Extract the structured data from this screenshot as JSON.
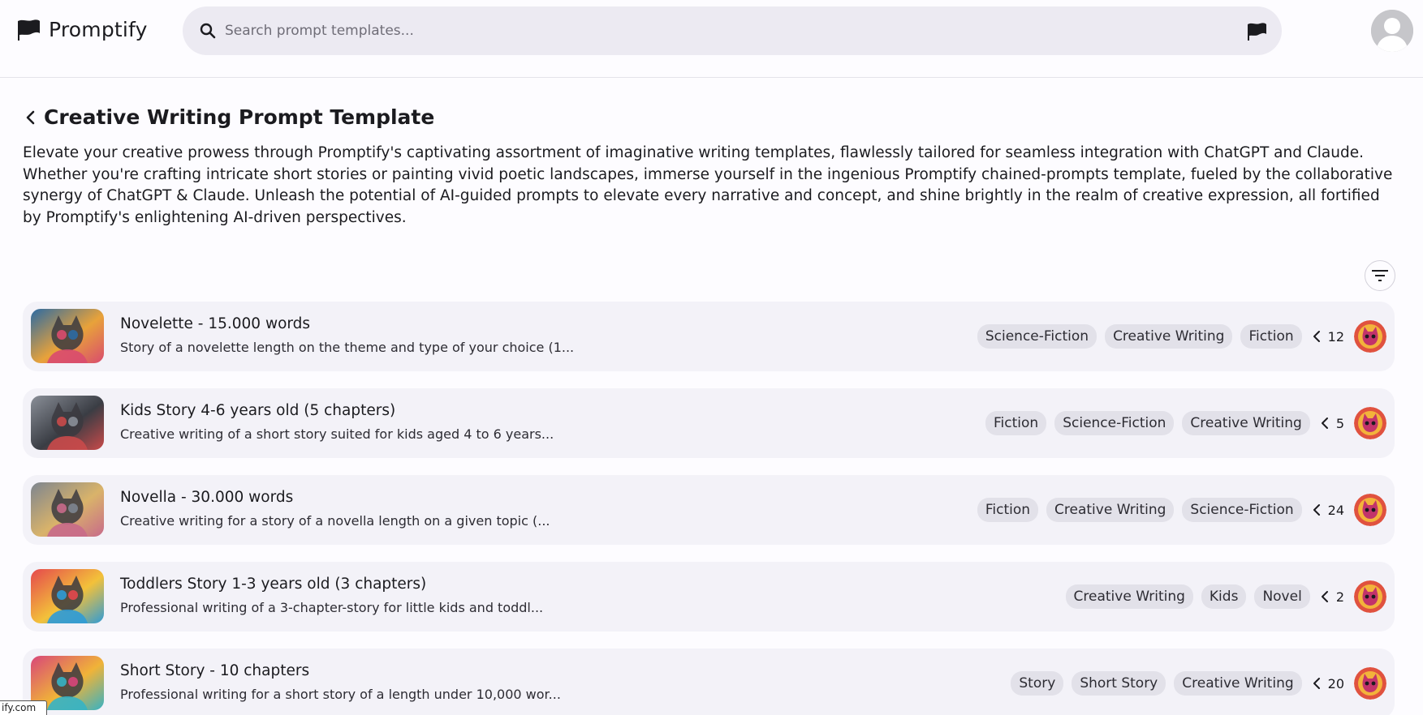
{
  "app": {
    "name": "Promptify",
    "search_placeholder": "Search prompt templates..."
  },
  "page": {
    "title": "Creative Writing Prompt Template",
    "description": "Elevate your creative prowess through Promptify's captivating assortment of imaginative writing templates, flawlessly tailored for seamless integration with ChatGPT and Claude. Whether you're crafting intricate short stories or painting vivid poetic landscapes, immerse yourself in the ingenious Promptify chained-prompts template, fueled by the collaborative synergy of ChatGPT & Claude. Unleash the potential of AI-guided prompts to elevate every narrative and concept, and shine brightly in the realm of creative expression, all fortified by Promptify's enlightening AI-driven perspectives."
  },
  "templates": [
    {
      "title": "Novelette - 15.000 words",
      "description": "Story of a novelette length on the theme and type of your choice (1...",
      "tags": [
        "Science-Fiction",
        "Creative Writing",
        "Fiction"
      ],
      "count": "12",
      "thumb_colors": [
        "#2b6aa3",
        "#d94b6e",
        "#e8a23a"
      ]
    },
    {
      "title": "Kids Story 4-6 years old (5 chapters)",
      "description": "Creative writing of a short story suited for kids aged 4 to 6 years...",
      "tags": [
        "Fiction",
        "Science-Fiction",
        "Creative Writing"
      ],
      "count": "5",
      "thumb_colors": [
        "#8a8f98",
        "#c94a4a",
        "#3a3d44"
      ]
    },
    {
      "title": "Novella - 30.000 words",
      "description": "Creative writing for a story of a novella length on a given topic (...",
      "tags": [
        "Fiction",
        "Creative Writing",
        "Science-Fiction"
      ],
      "count": "24",
      "thumb_colors": [
        "#7d8590",
        "#c86a8a",
        "#d9b36a"
      ]
    },
    {
      "title": "Toddlers Story 1-3 years old (3 chapters)",
      "description": "Professional writing of a 3-chapter-story for little kids and toddl...",
      "tags": [
        "Creative Writing",
        "Kids",
        "Novel"
      ],
      "count": "2",
      "thumb_colors": [
        "#e5484d",
        "#2f9bd6",
        "#f3c13a"
      ]
    },
    {
      "title": "Short Story - 10 chapters",
      "description": "Professional writing for a short story of a length under 10,000 wor...",
      "tags": [
        "Story",
        "Short Story",
        "Creative Writing"
      ],
      "count": "20",
      "thumb_colors": [
        "#d8467a",
        "#36b2c4",
        "#f0b338"
      ]
    }
  ],
  "status_bar": {
    "text": "ify.com"
  },
  "colors": {
    "background": "#fdfcff",
    "search_bg": "#eceaf2",
    "card_bg": "#f3f2f8",
    "tag_bg": "#e2e1e9"
  }
}
